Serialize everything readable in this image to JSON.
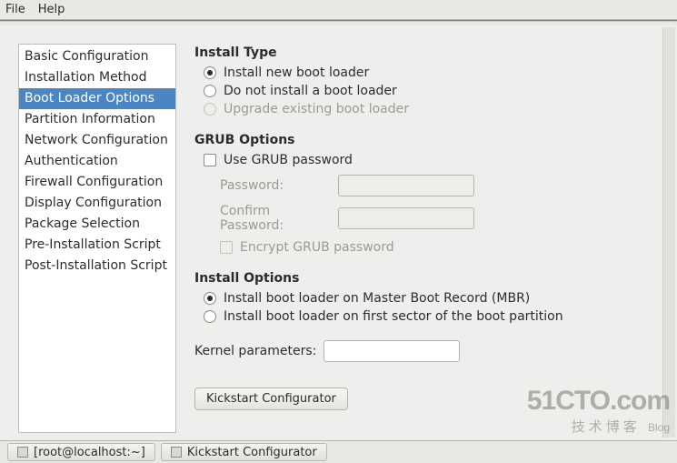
{
  "menubar": {
    "file": "File",
    "help": "Help"
  },
  "sidebar": {
    "items": [
      {
        "label": "Basic Configuration"
      },
      {
        "label": "Installation Method"
      },
      {
        "label": "Boot Loader Options",
        "selected": true
      },
      {
        "label": "Partition Information"
      },
      {
        "label": "Network Configuration"
      },
      {
        "label": "Authentication"
      },
      {
        "label": "Firewall Configuration"
      },
      {
        "label": "Display Configuration"
      },
      {
        "label": "Package Selection"
      },
      {
        "label": "Pre-Installation Script"
      },
      {
        "label": "Post-Installation Script"
      }
    ]
  },
  "install_type": {
    "title": "Install Type",
    "opt_new": "Install new boot loader",
    "opt_none": "Do not install a boot loader",
    "opt_upgrade": "Upgrade existing boot loader"
  },
  "grub": {
    "title": "GRUB Options",
    "use_password": "Use GRUB password",
    "password_label": "Password:",
    "confirm_label": "Confirm Password:",
    "encrypt_label": "Encrypt GRUB password"
  },
  "install_options": {
    "title": "Install Options",
    "opt_mbr": "Install boot loader on Master Boot Record (MBR)",
    "opt_first": "Install boot loader on first sector of the boot partition"
  },
  "kernel": {
    "label": "Kernel parameters:",
    "value": ""
  },
  "button": {
    "label": "Kickstart Configurator"
  },
  "taskbar": {
    "terminal": "[root@localhost:~]",
    "app": "Kickstart Configurator"
  },
  "watermark": {
    "line1": "51CTO.com",
    "line2": "技术博客",
    "tag": "Blog"
  }
}
